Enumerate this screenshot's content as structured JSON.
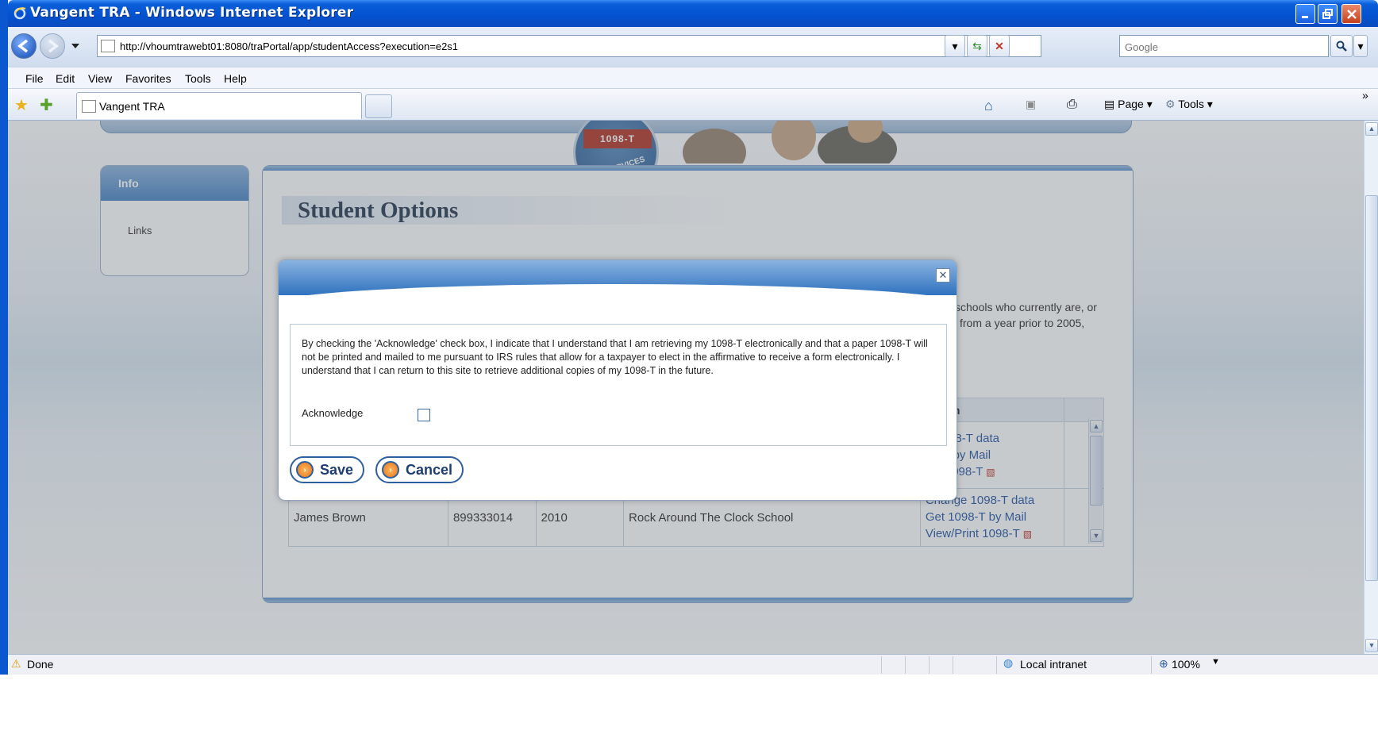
{
  "window": {
    "title": "Vangent TRA - Windows Internet Explorer"
  },
  "address_bar": {
    "url": "http://vhoumtrawebt01:8080/traPortal/app/studentAccess?execution=e2s1",
    "search_placeholder": "Google"
  },
  "menu": {
    "items": [
      "File",
      "Edit",
      "View",
      "Favorites",
      "Tools",
      "Help"
    ]
  },
  "tab": {
    "label": "Vangent TRA"
  },
  "command_bar": {
    "page_label": "Page",
    "tools_label": "Tools"
  },
  "page": {
    "logo_text": "1098-T",
    "logo_sub": "SERVICES",
    "sidebar": {
      "header": "Info",
      "link": "Links"
    },
    "title": "Student Options",
    "intro_line1": "schools who currently are, or",
    "intro_line2": "from a year prior to 2005,",
    "table": {
      "action_header": "Action",
      "rows": [
        {
          "links": [
            "e 1098-T data",
            "98-T by Mail",
            "rint 1098-T"
          ]
        },
        {
          "name": "James Brown",
          "id": "899333014",
          "year": "2010",
          "school": "Rock Around The Clock School",
          "links": [
            "Change 1098-T data",
            "Get 1098-T by Mail",
            "View/Print 1098-T"
          ]
        }
      ]
    }
  },
  "modal": {
    "text": "By checking the 'Acknowledge' check box, I indicate that I understand that I am retrieving my 1098-T electronically and that a paper 1098-T will not be printed and mailed to me pursuant to IRS rules that allow for a taxpayer to elect in the affirmative to receive a form electronically. I understand that I can return to this site to retrieve additional copies of my 1098-T in the future.",
    "acknowledge_label": "Acknowledge",
    "acknowledge_checked": false,
    "save_label": "Save",
    "cancel_label": "Cancel"
  },
  "status_bar": {
    "status": "Done",
    "zone": "Local intranet",
    "zoom": "100%"
  },
  "colors": {
    "titlebar": "#0451cf",
    "link": "#2b5aa6",
    "modal_header": "#2f72bf"
  }
}
